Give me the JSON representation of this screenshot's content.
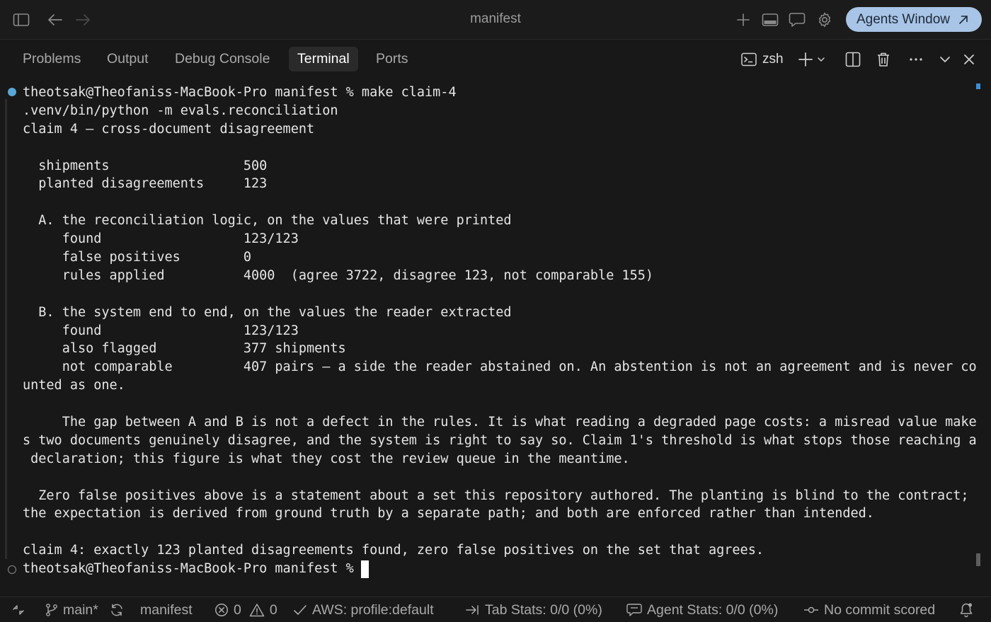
{
  "window": {
    "title": "manifest",
    "agents_button_label": "Agents Window"
  },
  "panel": {
    "tabs": [
      "Problems",
      "Output",
      "Debug Console",
      "Terminal",
      "Ports"
    ],
    "active_tab": "Terminal",
    "shell_label": "zsh"
  },
  "terminal": {
    "lines": [
      "theotsak@Theofaniss-MacBook-Pro manifest % make claim-4",
      ".venv/bin/python -m evals.reconciliation",
      "claim 4 — cross-document disagreement",
      "",
      "  shipments                 500",
      "  planted disagreements     123",
      "",
      "  A. the reconciliation logic, on the values that were printed",
      "     found                  123/123",
      "     false positives        0",
      "     rules applied          4000  (agree 3722, disagree 123, not comparable 155)",
      "",
      "  B. the system end to end, on the values the reader extracted",
      "     found                  123/123",
      "     also flagged           377 shipments",
      "     not comparable         407 pairs — a side the reader abstained on. An abstention is not an agreement and is never co",
      "unted as one.",
      "",
      "     The gap between A and B is not a defect in the rules. It is what reading a degraded page costs: a misread value make",
      "s two documents genuinely disagree, and the system is right to say so. Claim 1's threshold is what stops those reaching a",
      " declaration; this figure is what they cost the review queue in the meantime.",
      "",
      "  Zero false positives above is a statement about a set this repository authored. The planting is blind to the contract;",
      "the expectation is derived from ground truth by a separate path; and both are enforced rather than intended.",
      "",
      "claim 4: exactly 123 planted disagreements found, zero false positives on the set that agrees.",
      "theotsak@Theofaniss-MacBook-Pro manifest % "
    ]
  },
  "statusbar": {
    "branch": "main*",
    "folder": "manifest",
    "errors": "0",
    "warnings": "0",
    "aws": "AWS: profile:default",
    "tab_stats": "Tab Stats: 0/0 (0%)",
    "agent_stats": "Agent Stats: 0/0 (0%)",
    "commit": "No commit scored"
  },
  "icons": {
    "sidebar_toggle": "sidebar-toggle-icon",
    "back": "arrow-left-icon",
    "forward": "arrow-right-icon",
    "new": "plus-icon",
    "panel": "panel-layout-icon",
    "chat": "chat-bubble-icon",
    "settings": "gear-icon",
    "external": "arrow-up-right-icon",
    "terminal": "terminal-icon",
    "split": "split-terminal-icon",
    "trash": "trash-icon",
    "more": "more-icon",
    "collapse": "chevron-down-icon",
    "close": "close-icon"
  },
  "colors": {
    "background": "#181818",
    "accent_button": "#a8c4e6",
    "prompt_dot": "#5aa7d6",
    "text": "#e6e6e6"
  }
}
